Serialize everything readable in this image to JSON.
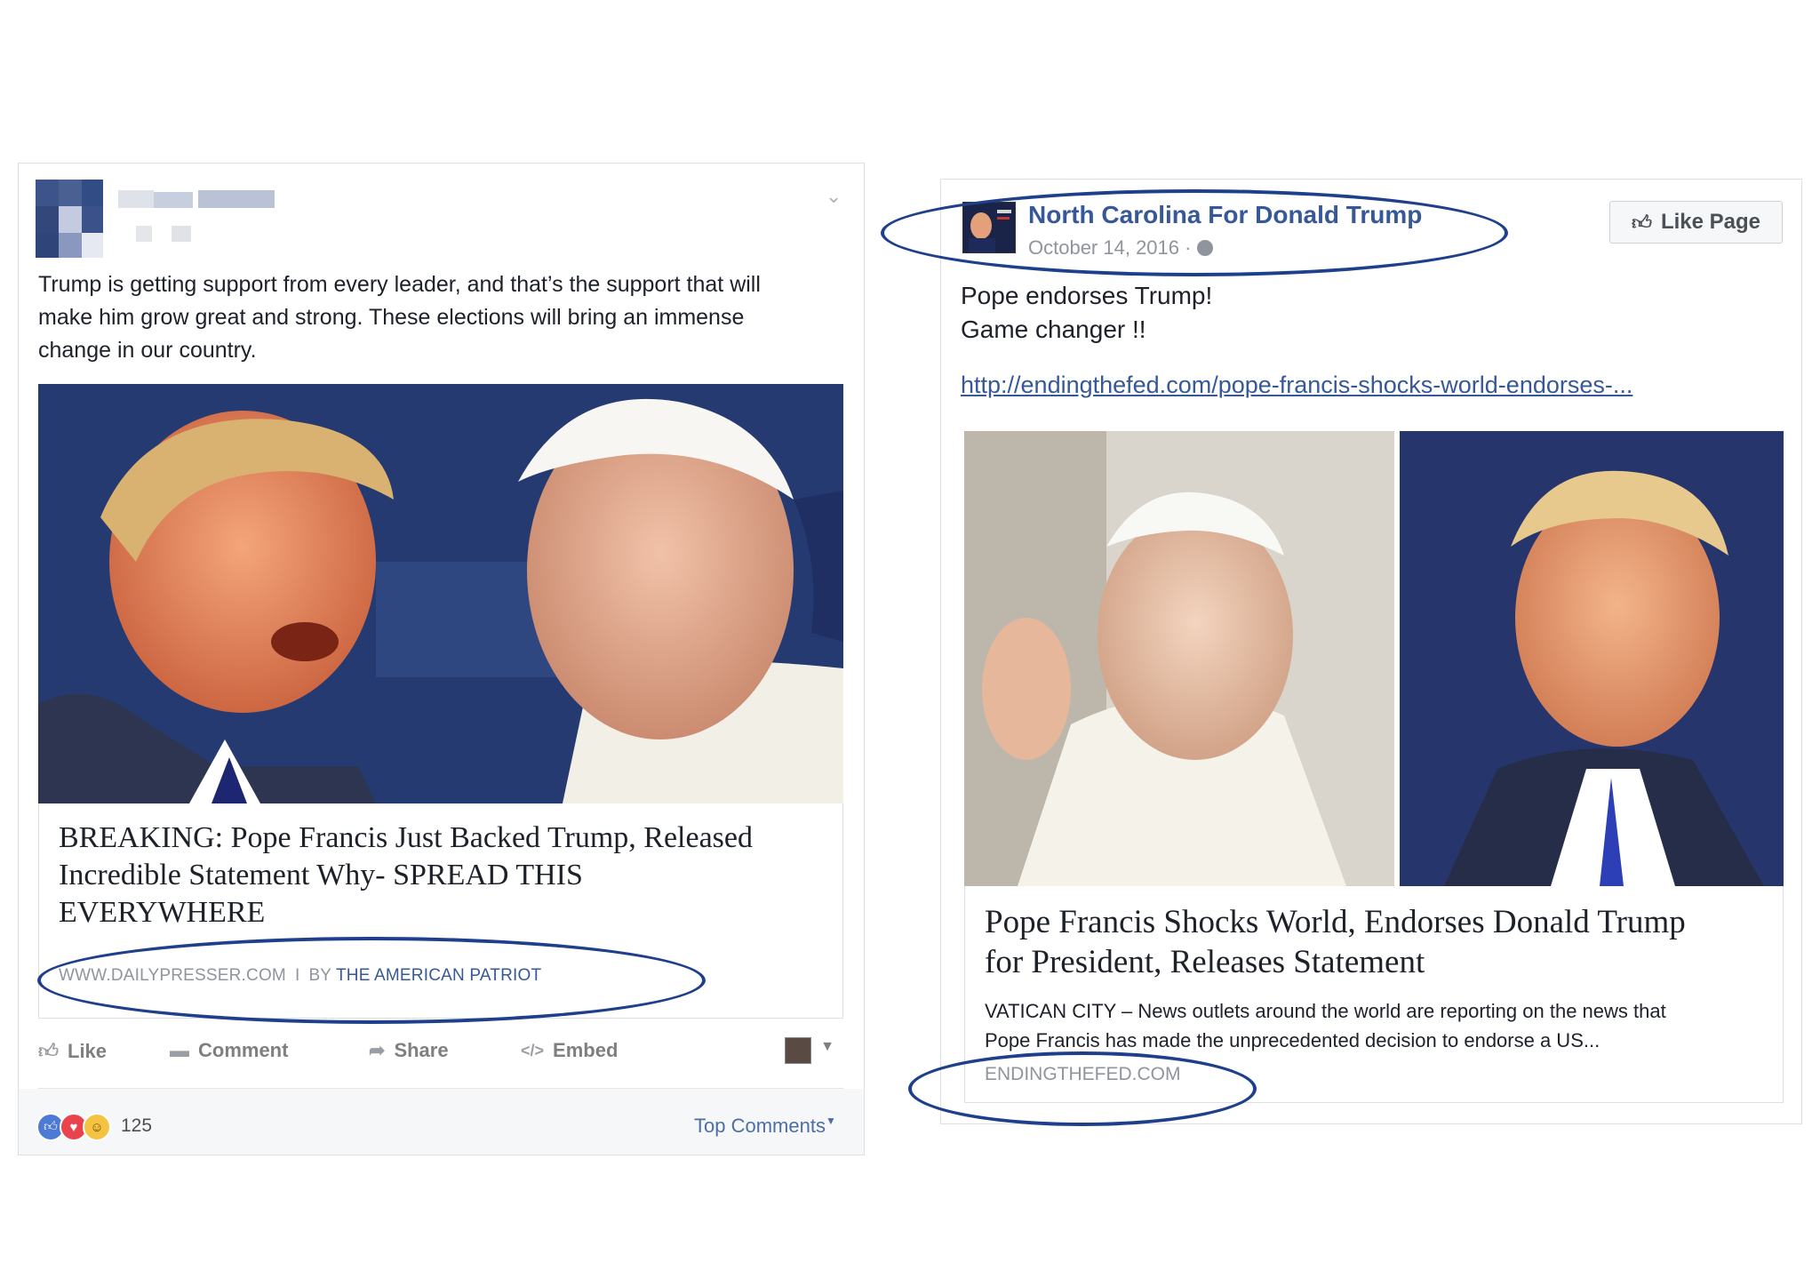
{
  "left_post": {
    "author_name": "",
    "post_text": [
      "Trump is getting support from every leader, and that’s the support that will",
      "make him grow great and strong. These elections will bring an immense",
      "change in our country."
    ],
    "article": {
      "title_lines": [
        "BREAKING: Pope Francis Just Backed Trump, Released",
        "Incredible Statement Why- SPREAD THIS",
        "EVERYWHERE"
      ],
      "domain": "WWW.DAILYPRESSER.COM",
      "separator": "I",
      "by": "BY",
      "author": "THE AMERICAN PATRIOT"
    },
    "actions": {
      "like": "Like",
      "comment": "Comment",
      "share": "Share",
      "embed": "Embed"
    },
    "reaction_count": "125",
    "top_comments": "Top Comments"
  },
  "right_post": {
    "page_name": "North Carolina For Donald Trump",
    "date": "October 14, 2016 ·",
    "like_page": "Like Page",
    "post_text": [
      "Pope endorses Trump!",
      "Game changer !!"
    ],
    "link": "http://endingthefed.com/pope-francis-shocks-world-endorses-...",
    "article": {
      "title_lines": [
        "Pope Francis Shocks World, Endorses Donald Trump",
        "for President, Releases Statement"
      ],
      "description_lines": [
        "VATICAN CITY – News outlets around the world are reporting on the news that",
        "Pope Francis has made the unprecedented decision to endorse a US..."
      ],
      "source": "ENDINGTHEFED.COM"
    }
  },
  "colors": {
    "facebook_blue": "#365899",
    "ellipse_blue": "#1e3f8c",
    "muted_text": "#90949c",
    "like_blue": "#4d7ad4",
    "love_red": "#e9434e",
    "haha_yellow": "#f4c341"
  },
  "icons": {
    "like": "thumbs-up-icon",
    "comment": "speech-bubble-icon",
    "share": "share-arrow-icon",
    "embed": "code-brackets-icon",
    "globe": "globe-icon",
    "chevron": "chevron-down-icon"
  }
}
